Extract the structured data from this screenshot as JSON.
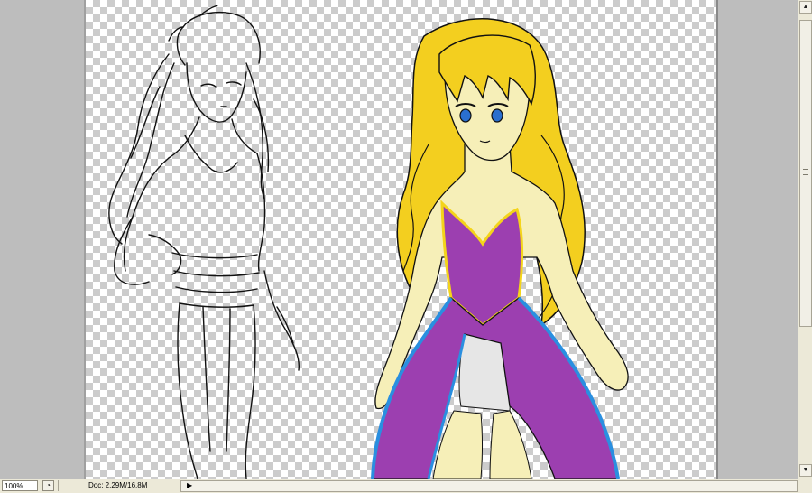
{
  "status_bar": {
    "zoom_value": "100%",
    "doc_info": "Doc: 2.29M/16.8M"
  },
  "icons": {
    "navigator": "navigator-icon",
    "scroll_up": "arrow-up-icon",
    "scroll_down": "arrow-down-icon",
    "scroll_right": "arrow-right-icon"
  },
  "colors": {
    "hair": "#f3cf1f",
    "dress": "#9c3fb0",
    "dress_trim_gold": "#f4d41a",
    "dress_trim_blue": "#2a8fe0",
    "skin": "#f6efb8",
    "eyes": "#2a6fcf",
    "underskirt": "#e6e6e6"
  }
}
